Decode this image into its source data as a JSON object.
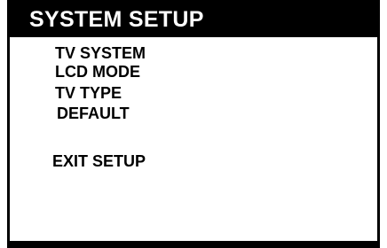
{
  "menu": {
    "title": "SYSTEM SETUP",
    "items": [
      {
        "label": "TV SYSTEM"
      },
      {
        "label": "LCD MODE"
      },
      {
        "label": "TV TYPE"
      },
      {
        "label": "DEFAULT"
      }
    ],
    "exit_label": "EXIT SETUP"
  },
  "colors": {
    "background": "#ffffff",
    "title_bar": "#000000",
    "title_text": "#ffffff",
    "item_text": "#000000"
  }
}
